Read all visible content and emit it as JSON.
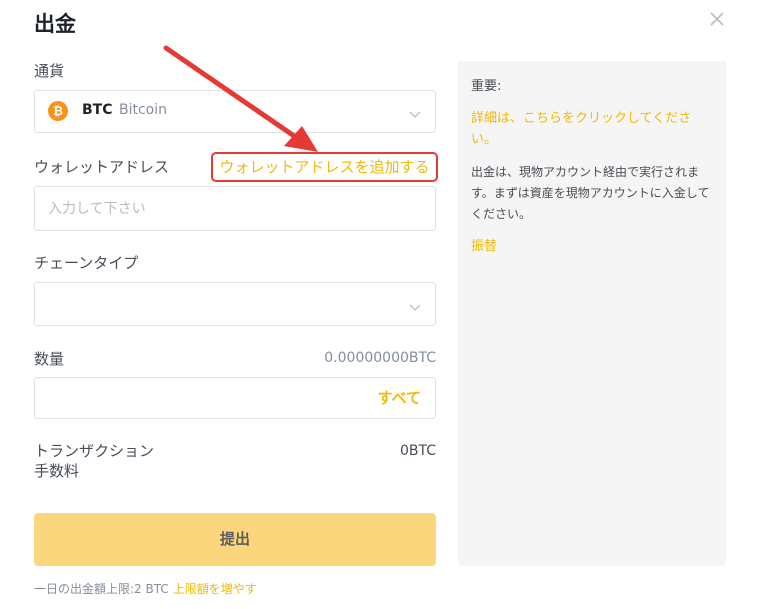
{
  "dialog": {
    "title": "出金"
  },
  "currency": {
    "label": "通貨",
    "symbol": "BTC",
    "name": "Bitcoin",
    "icon_glyph": "₿",
    "icon_color": "#f7931a"
  },
  "wallet": {
    "label": "ウォレットアドレス",
    "add_link": "ウォレットアドレスを追加する",
    "placeholder": "入力して下さい"
  },
  "chain": {
    "label": "チェーンタイプ",
    "value": ""
  },
  "amount": {
    "label": "数量",
    "available": "0.00000000BTC",
    "all_button": "すべて"
  },
  "fee": {
    "label_line1": "トランザクション",
    "label_line2": "手数料",
    "value": "0BTC"
  },
  "submit_label": "提出",
  "limit": {
    "text": "一日の出金額上限:2 BTC",
    "link": "上限額を増やす"
  },
  "notice": {
    "heading": "重要:",
    "link": "詳細は、こちらをクリックしてください。",
    "body": "出金は、現物アカウント経由で実行されます。まずは資産を現物アカウントに入金してください。",
    "transfer": "振替"
  },
  "colors": {
    "accent": "#f0b90b",
    "submit_bg": "#fbd67d",
    "annotation": "#e53935",
    "panel_bg": "#f5f5f5"
  }
}
